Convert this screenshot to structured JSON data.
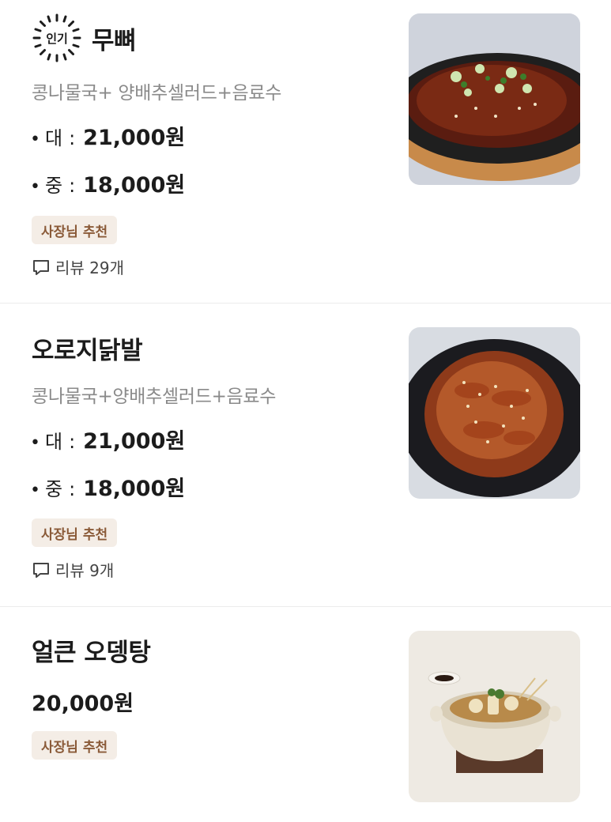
{
  "menu": [
    {
      "popular_label": "인기",
      "name": "무뼈",
      "description": "콩나물국+ 양배추셀러드+음료수",
      "prices": [
        {
          "size": "대",
          "amount": "21,000원"
        },
        {
          "size": "중",
          "amount": "18,000원"
        }
      ],
      "recommend": "사장님 추천",
      "reviews": "리뷰 29개",
      "image_icon": "spicy-boneless-chicken-feet-photo"
    },
    {
      "name": "오로지닭발",
      "description": "콩나물국+양배추셀러드+음료수",
      "prices": [
        {
          "size": "대",
          "amount": "21,000원"
        },
        {
          "size": "중",
          "amount": "18,000원"
        }
      ],
      "recommend": "사장님 추천",
      "reviews": "리뷰 9개",
      "image_icon": "chicken-feet-with-sesame-photo"
    },
    {
      "name": "얼큰 오뎅탕",
      "price": "20,000원",
      "recommend": "사장님 추천",
      "image_icon": "fishcake-soup-pot-photo"
    }
  ]
}
